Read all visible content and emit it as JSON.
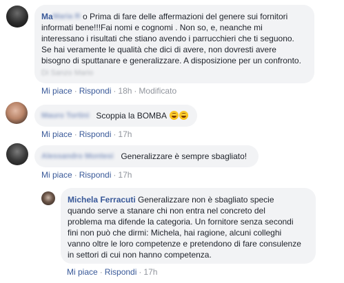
{
  "comments": [
    {
      "author": "Ma",
      "author_hidden": "Maria Rossi",
      "text_tail": "o Prima di fare delle affermazioni del genere sui fornitori",
      "lines": [
        "informati bene!!!Fai nomi e cognomi . Non so, e, neanche mi",
        "interessano i risultati che stiano avendo i parrucchieri che ti seguono.",
        "Se hai veramente le qualità che dici di avere, non dovresti avere",
        "bisogno di sputtanare e generalizzare. A disposizione per un confronto."
      ],
      "hidden_line": "Di Sanzo Mario",
      "actions": {
        "like": "Mi piace",
        "reply": "Rispondi",
        "time": "18h",
        "edited": "Modificato"
      }
    },
    {
      "author_hidden": "Mauro Tortini",
      "text": "Scoppia la BOMBA",
      "emoji": "grinning-sweat-emoji",
      "actions": {
        "like": "Mi piace",
        "reply": "Rispondi",
        "time": "17h"
      }
    },
    {
      "author_hidden": "Alessandro Montesi",
      "text": "Generalizzare è sempre sbagliato!",
      "actions": {
        "like": "Mi piace",
        "reply": "Rispondi",
        "time": "17h"
      }
    },
    {
      "author": "Michela Ferracuti",
      "first_line": "Generalizzare non è sbagliato specie",
      "lines": [
        "quando serve a stanare chi non entra nel concreto del",
        "problema ma difende la categoria. Un fornitore senza secondi",
        "fini non può che dirmi: Michela, hai ragione, alcuni colleghi",
        "vanno oltre le loro competenze e pretendono di fare consulenze",
        "in settori di cui non hanno competenza."
      ],
      "actions": {
        "like": "Mi piace",
        "reply": "Rispondi",
        "time": "17h"
      }
    }
  ],
  "separator": "·",
  "colors": {
    "link": "#385898",
    "bubble": "#f2f3f5",
    "meta": "#90949c",
    "text": "#1d2129"
  }
}
